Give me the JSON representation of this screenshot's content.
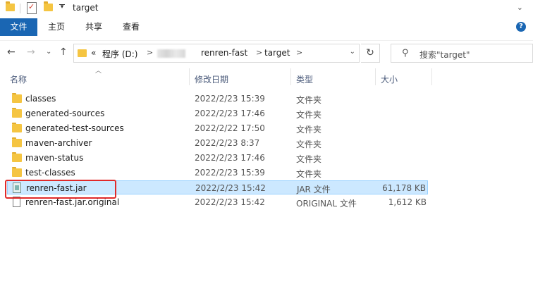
{
  "window": {
    "title": "target"
  },
  "ribbon": {
    "tabs": [
      "文件",
      "主页",
      "共享",
      "查看"
    ]
  },
  "address": {
    "overflow": "«",
    "crumbs": [
      "程序 (D:)",
      "renren-fast",
      "target"
    ],
    "separator": ">"
  },
  "search": {
    "placeholder": "搜索\"target\""
  },
  "columns": {
    "name": "名称",
    "date": "修改日期",
    "type": "类型",
    "size": "大小"
  },
  "files": [
    {
      "name": "classes",
      "date": "2022/2/23 15:39",
      "type": "文件夹",
      "size": "",
      "icon": "folder-icon"
    },
    {
      "name": "generated-sources",
      "date": "2022/2/23 17:46",
      "type": "文件夹",
      "size": "",
      "icon": "folder-icon"
    },
    {
      "name": "generated-test-sources",
      "date": "2022/2/22 17:50",
      "type": "文件夹",
      "size": "",
      "icon": "folder-icon"
    },
    {
      "name": "maven-archiver",
      "date": "2022/2/23 8:37",
      "type": "文件夹",
      "size": "",
      "icon": "folder-icon"
    },
    {
      "name": "maven-status",
      "date": "2022/2/23 17:46",
      "type": "文件夹",
      "size": "",
      "icon": "folder-icon"
    },
    {
      "name": "test-classes",
      "date": "2022/2/23 15:39",
      "type": "文件夹",
      "size": "",
      "icon": "folder-icon"
    },
    {
      "name": "renren-fast.jar",
      "date": "2022/2/23 15:42",
      "type": "JAR 文件",
      "size": "61,178 KB",
      "icon": "jar-icon",
      "selected": true
    },
    {
      "name": "renren-fast.jar.original",
      "date": "2022/2/23 15:42",
      "type": "ORIGINAL 文件",
      "size": "1,612 KB",
      "icon": "file-icon"
    }
  ],
  "colors": {
    "accent": "#1a66b3",
    "selection": "#cce8ff",
    "highlight": "#e02a2a"
  }
}
